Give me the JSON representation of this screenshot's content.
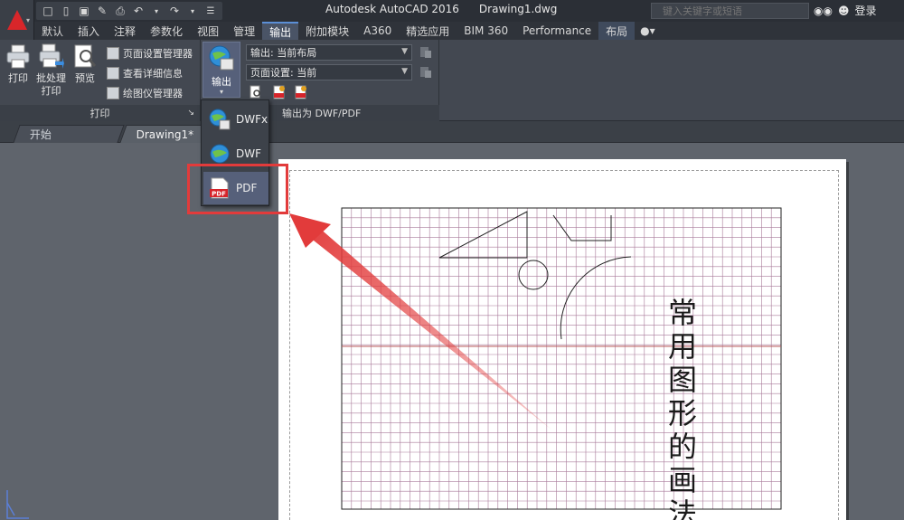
{
  "app": {
    "product": "Autodesk AutoCAD 2016",
    "document": "Drawing1.dwg"
  },
  "search": {
    "placeholder": "键入关键字或短语"
  },
  "user": {
    "login_label": "登录"
  },
  "ribbon_tabs": [
    {
      "label": "默认",
      "active": false
    },
    {
      "label": "插入",
      "active": false
    },
    {
      "label": "注释",
      "active": false
    },
    {
      "label": "参数化",
      "active": false
    },
    {
      "label": "视图",
      "active": false
    },
    {
      "label": "管理",
      "active": false
    },
    {
      "label": "输出",
      "active": true
    },
    {
      "label": "附加模块",
      "active": false
    },
    {
      "label": "A360",
      "active": false
    },
    {
      "label": "精选应用",
      "active": false
    },
    {
      "label": "BIM 360",
      "active": false
    },
    {
      "label": "Performance",
      "active": false
    },
    {
      "label": "布局",
      "active": false
    }
  ],
  "print_panel": {
    "title": "打印",
    "print_label": "打印",
    "batch_label_1": "批处理",
    "batch_label_2": "打印",
    "preview_label": "预览",
    "page_setup_manager": "页面设置管理器",
    "view_details": "查看详细信息",
    "plotter_manager": "绘图仪管理器"
  },
  "export_panel": {
    "title": "输出为 DWF/PDF",
    "export_button": "输出",
    "output_dropdown": "输出: 当前布局",
    "page_setup_dropdown": "页面设置: 当前"
  },
  "export_menu": [
    {
      "label": "DWFx",
      "icon": "dwfx-icon"
    },
    {
      "label": "DWF",
      "icon": "dwf-icon"
    },
    {
      "label": "PDF",
      "icon": "pdf-icon",
      "highlighted": true
    }
  ],
  "doc_tabs": [
    {
      "label": "开始",
      "active": false
    },
    {
      "label": "Drawing1*",
      "active": true
    }
  ],
  "drawing": {
    "vertical_text": "常用图形的画法"
  },
  "colors": {
    "highlight_red": "#e23b3b",
    "grid_line": "#a97a9a",
    "grid_axis": "#b85a5a",
    "active_tab": "#4a5466"
  }
}
